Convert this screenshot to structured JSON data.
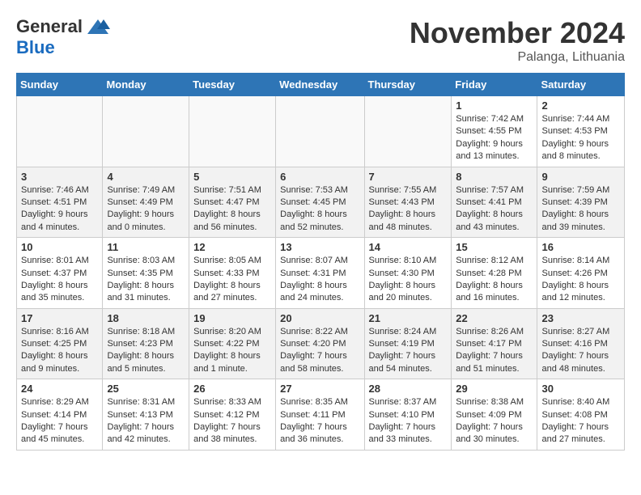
{
  "header": {
    "logo_general": "General",
    "logo_blue": "Blue",
    "month_title": "November 2024",
    "location": "Palanga, Lithuania"
  },
  "weekdays": [
    "Sunday",
    "Monday",
    "Tuesday",
    "Wednesday",
    "Thursday",
    "Friday",
    "Saturday"
  ],
  "weeks": [
    [
      {
        "day": "",
        "info": ""
      },
      {
        "day": "",
        "info": ""
      },
      {
        "day": "",
        "info": ""
      },
      {
        "day": "",
        "info": ""
      },
      {
        "day": "",
        "info": ""
      },
      {
        "day": "1",
        "info": "Sunrise: 7:42 AM\nSunset: 4:55 PM\nDaylight: 9 hours\nand 13 minutes."
      },
      {
        "day": "2",
        "info": "Sunrise: 7:44 AM\nSunset: 4:53 PM\nDaylight: 9 hours\nand 8 minutes."
      }
    ],
    [
      {
        "day": "3",
        "info": "Sunrise: 7:46 AM\nSunset: 4:51 PM\nDaylight: 9 hours\nand 4 minutes."
      },
      {
        "day": "4",
        "info": "Sunrise: 7:49 AM\nSunset: 4:49 PM\nDaylight: 9 hours\nand 0 minutes."
      },
      {
        "day": "5",
        "info": "Sunrise: 7:51 AM\nSunset: 4:47 PM\nDaylight: 8 hours\nand 56 minutes."
      },
      {
        "day": "6",
        "info": "Sunrise: 7:53 AM\nSunset: 4:45 PM\nDaylight: 8 hours\nand 52 minutes."
      },
      {
        "day": "7",
        "info": "Sunrise: 7:55 AM\nSunset: 4:43 PM\nDaylight: 8 hours\nand 48 minutes."
      },
      {
        "day": "8",
        "info": "Sunrise: 7:57 AM\nSunset: 4:41 PM\nDaylight: 8 hours\nand 43 minutes."
      },
      {
        "day": "9",
        "info": "Sunrise: 7:59 AM\nSunset: 4:39 PM\nDaylight: 8 hours\nand 39 minutes."
      }
    ],
    [
      {
        "day": "10",
        "info": "Sunrise: 8:01 AM\nSunset: 4:37 PM\nDaylight: 8 hours\nand 35 minutes."
      },
      {
        "day": "11",
        "info": "Sunrise: 8:03 AM\nSunset: 4:35 PM\nDaylight: 8 hours\nand 31 minutes."
      },
      {
        "day": "12",
        "info": "Sunrise: 8:05 AM\nSunset: 4:33 PM\nDaylight: 8 hours\nand 27 minutes."
      },
      {
        "day": "13",
        "info": "Sunrise: 8:07 AM\nSunset: 4:31 PM\nDaylight: 8 hours\nand 24 minutes."
      },
      {
        "day": "14",
        "info": "Sunrise: 8:10 AM\nSunset: 4:30 PM\nDaylight: 8 hours\nand 20 minutes."
      },
      {
        "day": "15",
        "info": "Sunrise: 8:12 AM\nSunset: 4:28 PM\nDaylight: 8 hours\nand 16 minutes."
      },
      {
        "day": "16",
        "info": "Sunrise: 8:14 AM\nSunset: 4:26 PM\nDaylight: 8 hours\nand 12 minutes."
      }
    ],
    [
      {
        "day": "17",
        "info": "Sunrise: 8:16 AM\nSunset: 4:25 PM\nDaylight: 8 hours\nand 9 minutes."
      },
      {
        "day": "18",
        "info": "Sunrise: 8:18 AM\nSunset: 4:23 PM\nDaylight: 8 hours\nand 5 minutes."
      },
      {
        "day": "19",
        "info": "Sunrise: 8:20 AM\nSunset: 4:22 PM\nDaylight: 8 hours\nand 1 minute."
      },
      {
        "day": "20",
        "info": "Sunrise: 8:22 AM\nSunset: 4:20 PM\nDaylight: 7 hours\nand 58 minutes."
      },
      {
        "day": "21",
        "info": "Sunrise: 8:24 AM\nSunset: 4:19 PM\nDaylight: 7 hours\nand 54 minutes."
      },
      {
        "day": "22",
        "info": "Sunrise: 8:26 AM\nSunset: 4:17 PM\nDaylight: 7 hours\nand 51 minutes."
      },
      {
        "day": "23",
        "info": "Sunrise: 8:27 AM\nSunset: 4:16 PM\nDaylight: 7 hours\nand 48 minutes."
      }
    ],
    [
      {
        "day": "24",
        "info": "Sunrise: 8:29 AM\nSunset: 4:14 PM\nDaylight: 7 hours\nand 45 minutes."
      },
      {
        "day": "25",
        "info": "Sunrise: 8:31 AM\nSunset: 4:13 PM\nDaylight: 7 hours\nand 42 minutes."
      },
      {
        "day": "26",
        "info": "Sunrise: 8:33 AM\nSunset: 4:12 PM\nDaylight: 7 hours\nand 38 minutes."
      },
      {
        "day": "27",
        "info": "Sunrise: 8:35 AM\nSunset: 4:11 PM\nDaylight: 7 hours\nand 36 minutes."
      },
      {
        "day": "28",
        "info": "Sunrise: 8:37 AM\nSunset: 4:10 PM\nDaylight: 7 hours\nand 33 minutes."
      },
      {
        "day": "29",
        "info": "Sunrise: 8:38 AM\nSunset: 4:09 PM\nDaylight: 7 hours\nand 30 minutes."
      },
      {
        "day": "30",
        "info": "Sunrise: 8:40 AM\nSunset: 4:08 PM\nDaylight: 7 hours\nand 27 minutes."
      }
    ]
  ]
}
